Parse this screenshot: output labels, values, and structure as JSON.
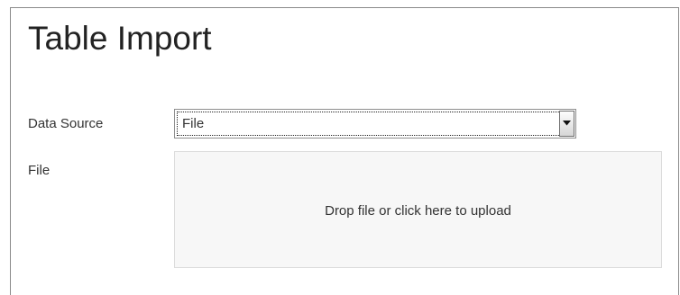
{
  "page": {
    "title": "Table Import"
  },
  "form": {
    "data_source": {
      "label": "Data Source",
      "selected": "File",
      "arrow_icon": "dropdown-arrow-icon"
    },
    "file": {
      "label": "File",
      "dropzone_text": "Drop file or click here to upload"
    }
  },
  "colors": {
    "border": "#8a8a8a",
    "dropzone_bg": "#f7f7f7",
    "text": "#333333"
  }
}
